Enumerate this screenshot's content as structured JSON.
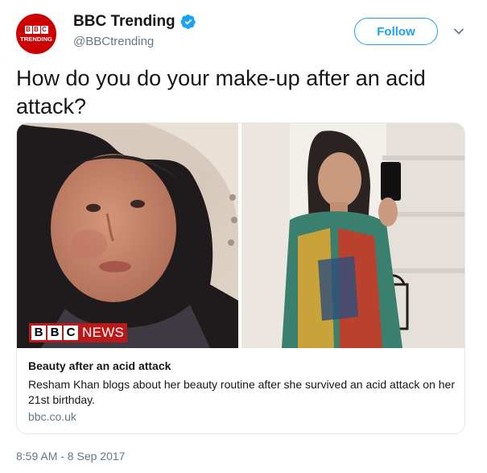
{
  "account": {
    "avatar_top": "BBC",
    "avatar_bottom": "TRENDING",
    "name": "BBC Trending",
    "handle": "@BBCtrending",
    "verified": true
  },
  "actions": {
    "follow_label": "Follow",
    "menu_icon": "chevron-down-icon"
  },
  "tweet": {
    "text": "How do you do your make-up after an acid attack?",
    "timestamp": "8:59 AM - 8 Sep 2017"
  },
  "card": {
    "badge_letters": [
      "B",
      "B",
      "C"
    ],
    "badge_word": "NEWS",
    "title": "Beauty after an acid attack",
    "description": "Resham Khan blogs about her beauty routine after she survived an acid attack on her 21st birthday.",
    "domain": "bbc.co.uk"
  },
  "colors": {
    "accent": "#1da1f2",
    "bbc_red": "#cc0000",
    "news_red": "#bb1919",
    "muted": "#657786"
  }
}
